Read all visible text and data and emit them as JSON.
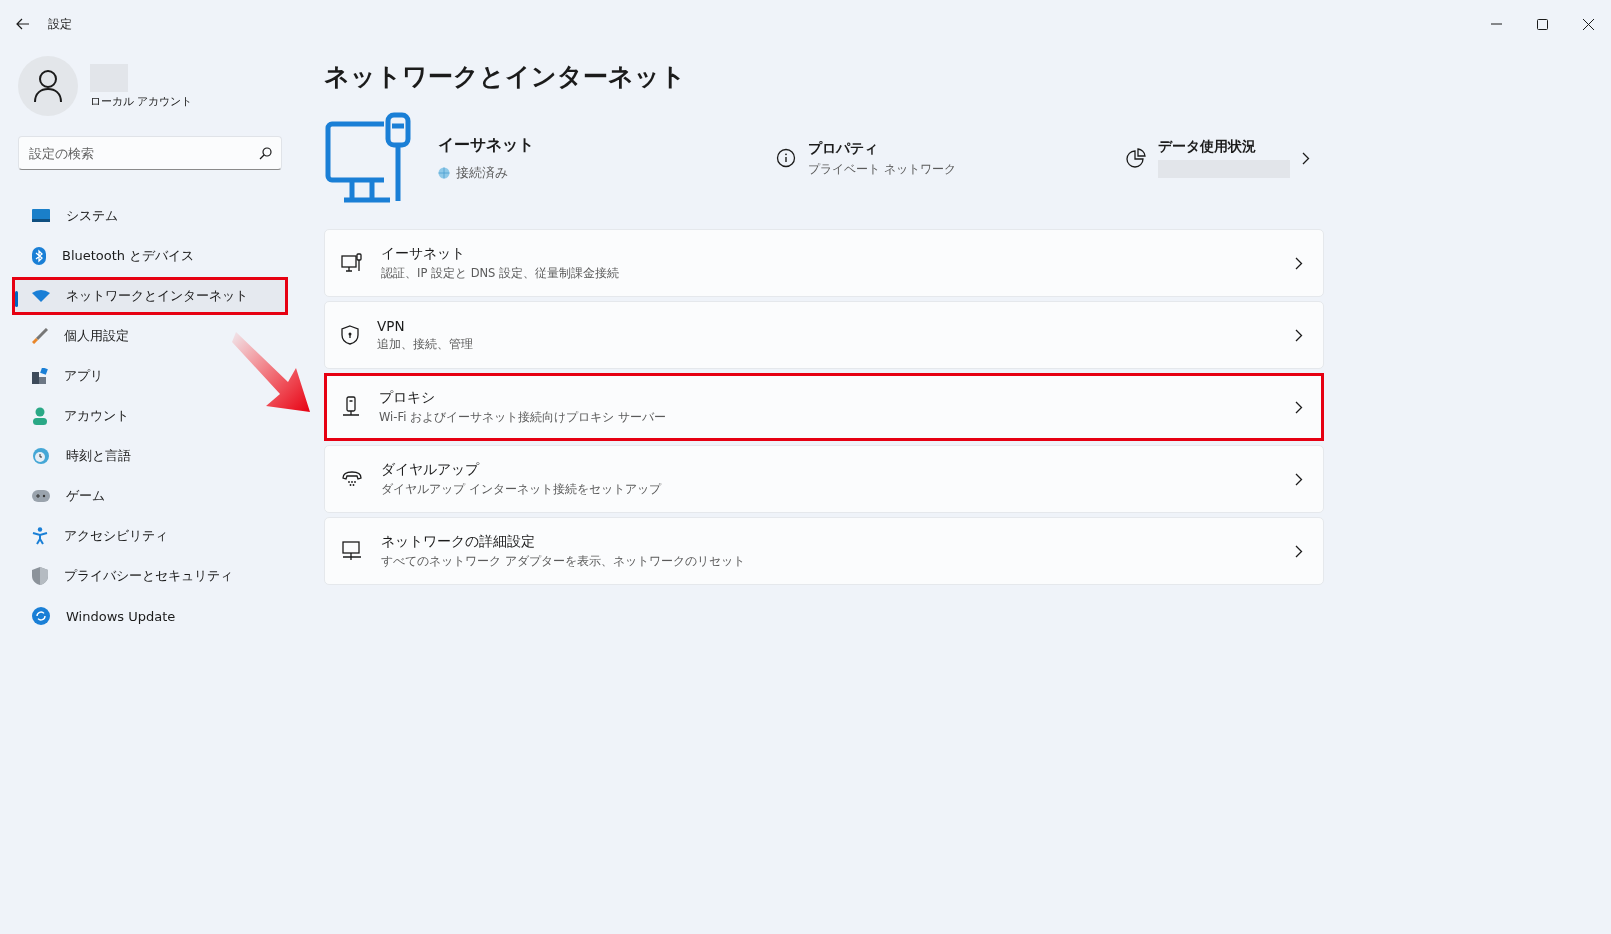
{
  "window": {
    "title": "設定"
  },
  "account": {
    "type": "ローカル アカウント"
  },
  "search": {
    "placeholder": "設定の検索"
  },
  "sidebar": {
    "items": [
      {
        "label": "システム",
        "selected": false,
        "highlighted": false
      },
      {
        "label": "Bluetooth とデバイス",
        "selected": false,
        "highlighted": false
      },
      {
        "label": "ネットワークとインターネット",
        "selected": true,
        "highlighted": true
      },
      {
        "label": "個人用設定",
        "selected": false,
        "highlighted": false
      },
      {
        "label": "アプリ",
        "selected": false,
        "highlighted": false
      },
      {
        "label": "アカウント",
        "selected": false,
        "highlighted": false
      },
      {
        "label": "時刻と言語",
        "selected": false,
        "highlighted": false
      },
      {
        "label": "ゲーム",
        "selected": false,
        "highlighted": false
      },
      {
        "label": "アクセシビリティ",
        "selected": false,
        "highlighted": false
      },
      {
        "label": "プライバシーとセキュリティ",
        "selected": false,
        "highlighted": false
      },
      {
        "label": "Windows Update",
        "selected": false,
        "highlighted": false
      }
    ]
  },
  "page": {
    "title": "ネットワークとインターネット"
  },
  "connection": {
    "name": "イーサネット",
    "status": "接続済み"
  },
  "properties": {
    "title": "プロパティ",
    "subtitle": "プライベート ネットワーク"
  },
  "data_usage": {
    "title": "データ使用状況"
  },
  "cards": [
    {
      "title": "イーサネット",
      "subtitle": "認証、IP 設定と DNS 設定、従量制課金接続",
      "highlighted": false
    },
    {
      "title": "VPN",
      "subtitle": "追加、接続、管理",
      "highlighted": false
    },
    {
      "title": "プロキシ",
      "subtitle": "Wi-Fi およびイーサネット接続向けプロキシ サーバー",
      "highlighted": true
    },
    {
      "title": "ダイヤルアップ",
      "subtitle": "ダイヤルアップ インターネット接続をセットアップ",
      "highlighted": false
    },
    {
      "title": "ネットワークの詳細設定",
      "subtitle": "すべてのネットワーク アダプターを表示、ネットワークのリセット",
      "highlighted": false
    }
  ]
}
